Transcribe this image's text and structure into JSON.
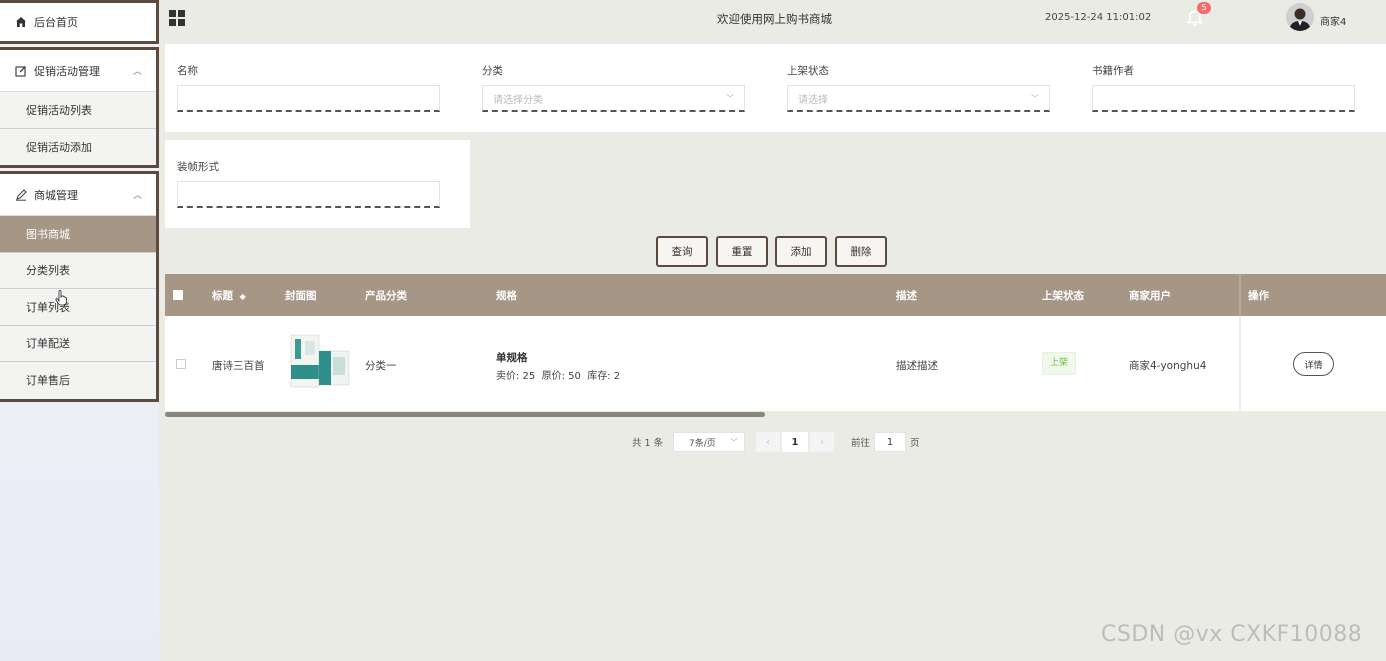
{
  "sidebar": {
    "home": {
      "label": "后台首页",
      "icon": "home-icon"
    },
    "groups": [
      {
        "label": "促销活动管理",
        "icon": "edit-square-icon",
        "items": [
          {
            "label": "促销活动列表"
          },
          {
            "label": "促销活动添加"
          }
        ]
      },
      {
        "label": "商城管理",
        "icon": "pen-icon",
        "items": [
          {
            "label": "图书商城",
            "active": true
          },
          {
            "label": "分类列表"
          },
          {
            "label": "订单列表"
          },
          {
            "label": "订单配送"
          },
          {
            "label": "订单售后"
          }
        ]
      }
    ]
  },
  "header": {
    "welcome": "欢迎使用网上购书商城",
    "datetime": "2025-12-24 11:01:02",
    "notification_count": "5",
    "username": "商家4"
  },
  "search": {
    "fields": [
      {
        "label": "名称",
        "placeholder": ""
      },
      {
        "label": "分类",
        "placeholder": "请选择分类"
      },
      {
        "label": "上架状态",
        "placeholder": "请选择"
      },
      {
        "label": "书籍作者",
        "placeholder": ""
      },
      {
        "label": "装帧形式",
        "placeholder": ""
      }
    ]
  },
  "actions": {
    "query": "查询",
    "reset": "重置",
    "add": "添加",
    "delete": "删除"
  },
  "table": {
    "headers": {
      "title": "标题",
      "sort_icon": "◆",
      "cover": "封面图",
      "category": "产品分类",
      "spec": "规格",
      "desc": "描述",
      "status": "上架状态",
      "merchant": "商家用户",
      "ops": "操作"
    },
    "rows": [
      {
        "title": "唐诗三百首",
        "category": "分类一",
        "spec_name": "单规格",
        "spec_detail": "卖价: 25  原价: 50  库存: 2",
        "desc": "描述描述",
        "status": "上架",
        "merchant": "商家4-yonghu4",
        "detail_btn": "详情"
      }
    ]
  },
  "pagination": {
    "total": "共 1 条",
    "page_size": "7条/页",
    "prev": "‹",
    "current": "1",
    "next": "›",
    "goto_label": "前往",
    "goto_value": "1",
    "page_unit": "页"
  },
  "watermark": "CSDN @vx  CXKF10088",
  "colors": {
    "accent": "#a59686",
    "border_dark": "#5c4a3f",
    "status_green": "#67c23a"
  }
}
